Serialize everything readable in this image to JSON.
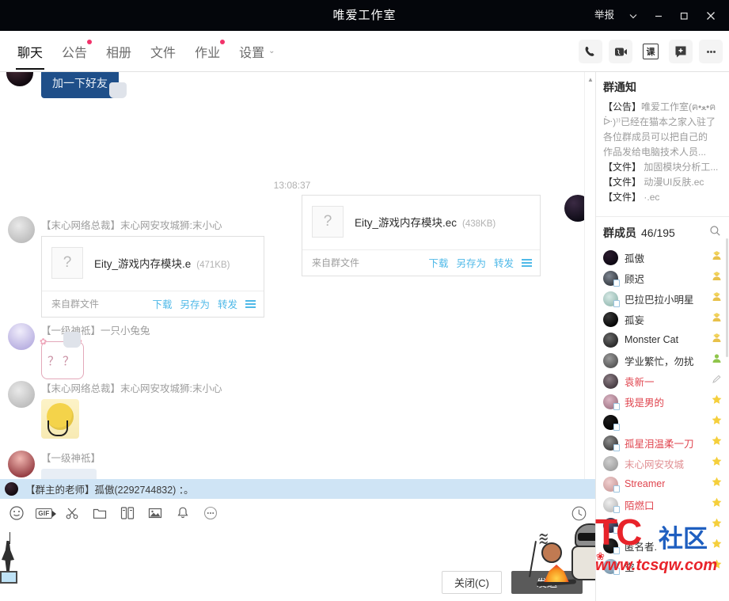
{
  "titlebar": {
    "title": "唯爱工作室",
    "report_label": "举报",
    "icons": {
      "chevron": "chevron-down-icon",
      "minimize": "minimize-icon",
      "maximize": "maximize-icon",
      "close": "close-icon"
    }
  },
  "tabs": [
    {
      "label": "聊天",
      "active": true,
      "dot": false
    },
    {
      "label": "公告",
      "active": false,
      "dot": true
    },
    {
      "label": "相册",
      "active": false,
      "dot": false
    },
    {
      "label": "文件",
      "active": false,
      "dot": false
    },
    {
      "label": "作业",
      "active": false,
      "dot": true
    },
    {
      "label": "设置",
      "active": false,
      "dot": false,
      "chevron": "⌄"
    }
  ],
  "header_icons": [
    {
      "name": "phone-call-icon",
      "label": "语音通话"
    },
    {
      "name": "video-call-icon",
      "label": "视频通话"
    },
    {
      "name": "class-icon",
      "label": "课"
    },
    {
      "name": "add-app-icon",
      "label": "添加"
    },
    {
      "name": "more-icon",
      "label": "更多"
    }
  ],
  "chat": {
    "timestamp": "13:08:37",
    "messages": [
      {
        "type": "self-bubble",
        "text": "加一下好友"
      },
      {
        "type": "file-right",
        "filename": "Eity_游戏内存模块.ec",
        "filesize": "(438KB)",
        "source": "来自群文件",
        "actions": [
          "下载",
          "另存为",
          "转发"
        ],
        "thumb": "?"
      },
      {
        "type": "file-left",
        "sender": "【末心网络总裁】末心网安攻城狮:末小心",
        "filename": "Eity_游戏内存模块.e",
        "filesize": "(471KB)",
        "source": "来自群文件",
        "actions": [
          "下载",
          "另存为",
          "转发"
        ],
        "thumb": "?"
      },
      {
        "type": "sticker-left",
        "sender": "【一级神祗】一只小兔兔",
        "sticker": "？？"
      },
      {
        "type": "sticker-left",
        "sender": "【末心网络总裁】末心网安攻城狮:末小心",
        "sticker": "yellow-face-sticker"
      },
      {
        "type": "sticker-left",
        "sender": "【一级神祗】",
        "sticker": "partial-sticker"
      }
    ],
    "selected_row": "【群主的老师】孤傲(2292744832) ：。"
  },
  "input_toolbar": [
    {
      "name": "emoji-icon",
      "label": "表情"
    },
    {
      "name": "gif-icon",
      "label": "GIF"
    },
    {
      "name": "scissors-icon",
      "label": "截图"
    },
    {
      "name": "folder-icon",
      "label": "文件"
    },
    {
      "name": "screenshot-icon",
      "label": "屏幕分享"
    },
    {
      "name": "image-icon",
      "label": "图片"
    },
    {
      "name": "bell-icon",
      "label": "抖动"
    },
    {
      "name": "more-dots-icon",
      "label": "更多"
    },
    {
      "name": "history-icon",
      "label": "消息记录"
    }
  ],
  "buttons": {
    "close": "关闭(C)",
    "send": "发送"
  },
  "right_panel": {
    "notice_title": "群通知",
    "notices": [
      {
        "key": "【公告】",
        "text": "唯爱工作室(ฅ•ﻌ•ฅ"
      },
      {
        "key": "",
        "text": "ᐕ)⁾⁾已经在猫本之家入驻了"
      },
      {
        "key": "",
        "text": "各位群成员可以把自己的"
      },
      {
        "key": "",
        "text": "作品发给电脑技术人员..."
      },
      {
        "key": "【文件】",
        "text": "加固模块分析工..."
      },
      {
        "key": "【文件】",
        "text": "动漫UI反肤.ec"
      },
      {
        "key": "【文件】",
        "text": "·.ec"
      }
    ],
    "members_title": "群成员",
    "members_count": "46/195",
    "search_icon": "search-icon",
    "members": [
      {
        "name": "孤傲",
        "color": "c1",
        "red": false,
        "faded": false,
        "badge": "crown",
        "qflag": false
      },
      {
        "name": "顾迟",
        "color": "c2",
        "red": false,
        "faded": false,
        "badge": "crown",
        "qflag": true
      },
      {
        "name": "巴拉巴拉小明星",
        "color": "c3",
        "red": false,
        "faded": false,
        "badge": "crown",
        "qflag": true
      },
      {
        "name": "孤妄",
        "color": "c4",
        "red": false,
        "faded": false,
        "badge": "crown",
        "qflag": false
      },
      {
        "name": "Monster Cat",
        "color": "c5",
        "red": false,
        "faded": false,
        "badge": "crown",
        "qflag": false
      },
      {
        "name": "学业繁忙，勿扰",
        "color": "c6",
        "red": false,
        "faded": false,
        "badge": "green",
        "qflag": false
      },
      {
        "name": "袁新一",
        "color": "c7",
        "red": true,
        "faded": false,
        "badge": "pen",
        "qflag": false
      },
      {
        "name": "我是男的",
        "color": "c8",
        "red": true,
        "faded": false,
        "badge": "star",
        "qflag": true
      },
      {
        "name": "",
        "color": "c9",
        "red": false,
        "faded": false,
        "badge": "star",
        "qflag": true
      },
      {
        "name": "孤星泪温柔一刀",
        "color": "c10",
        "red": true,
        "faded": false,
        "badge": "star",
        "qflag": true
      },
      {
        "name": "末心网安攻城",
        "color": "c11",
        "red": false,
        "faded": true,
        "badge": "star",
        "qflag": false
      },
      {
        "name": "Streamer",
        "color": "c12",
        "red": true,
        "faded": false,
        "badge": "star",
        "qflag": true
      },
      {
        "name": "陌燃口",
        "color": "c13",
        "red": true,
        "faded": false,
        "badge": "star",
        "qflag": true
      },
      {
        "name": "",
        "color": "c14",
        "red": false,
        "faded": false,
        "badge": "star",
        "qflag": true
      },
      {
        "name": "匿名者.",
        "color": "c15",
        "red": false,
        "faded": false,
        "badge": "star",
        "qflag": true
      },
      {
        "name": "空",
        "color": "c16",
        "red": false,
        "faded": false,
        "badge": "star",
        "qflag": true
      }
    ]
  },
  "watermark": {
    "brand": "TC",
    "suffix": "社区",
    "url": "www.tcsqw.com"
  }
}
